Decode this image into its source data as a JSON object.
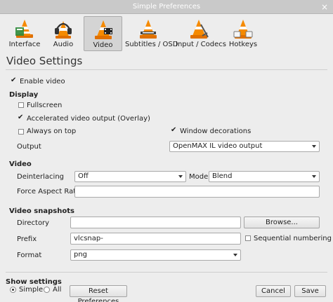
{
  "window": {
    "title": "Simple Preferences",
    "close_glyph": "×"
  },
  "toolbar": {
    "items": [
      {
        "label": "Interface",
        "icon": "interface-cone-icon"
      },
      {
        "label": "Audio",
        "icon": "audio-headphones-icon"
      },
      {
        "label": "Video",
        "icon": "video-cone-icon",
        "active": true
      },
      {
        "label": "Subtitles / OSD",
        "icon": "subtitles-cone-icon"
      },
      {
        "label": "Input / Codecs",
        "icon": "codecs-cone-icon"
      },
      {
        "label": "Hotkeys",
        "icon": "hotkeys-cone-icon"
      }
    ]
  },
  "page_title": "Video Settings",
  "enable_video": {
    "label": "Enable video",
    "checked": true
  },
  "display": {
    "title": "Display",
    "fullscreen": {
      "label": "Fullscreen",
      "checked": false
    },
    "accelerated": {
      "label": "Accelerated video output (Overlay)",
      "checked": true
    },
    "always_on_top": {
      "label": "Always on top",
      "checked": false
    },
    "window_decorations": {
      "label": "Window decorations",
      "checked": true
    },
    "output_label": "Output",
    "output_value": "OpenMAX IL video output"
  },
  "video": {
    "title": "Video",
    "deinterlacing_label": "Deinterlacing",
    "deinterlacing_value": "Off",
    "mode_label": "Mode",
    "mode_value": "Blend",
    "aspect_label": "Force Aspect Ratio",
    "aspect_value": ""
  },
  "snapshots": {
    "title": "Video snapshots",
    "directory_label": "Directory",
    "directory_value": "",
    "browse_label": "Browse...",
    "prefix_label": "Prefix",
    "prefix_value": "vlcsnap-",
    "sequential_label": "Sequential numbering",
    "sequential_checked": false,
    "format_label": "Format",
    "format_value": "png"
  },
  "footer": {
    "show_settings_title": "Show settings",
    "simple_label": "Simple",
    "all_label": "All",
    "selected": "Simple",
    "reset_label": "Reset Preferences",
    "cancel_label": "Cancel",
    "save_label": "Save"
  },
  "colors": {
    "background": "#ededed",
    "titlebar": "#c9c9c9",
    "cone_orange": "#f07c00"
  }
}
